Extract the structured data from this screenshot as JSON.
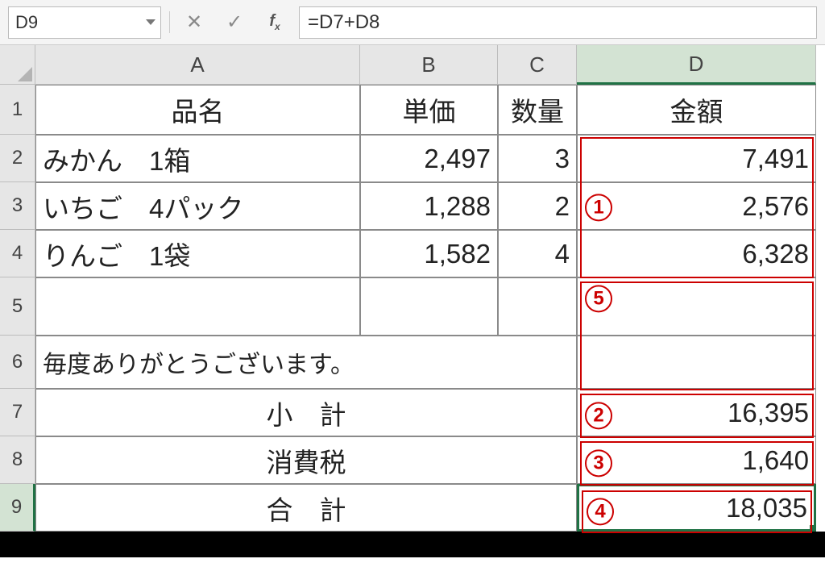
{
  "formula_bar": {
    "name_box": "D9",
    "cancel_glyph": "✕",
    "accept_glyph": "✓",
    "fx_label": "fx",
    "formula": "=D7+D8"
  },
  "columns": {
    "A": "A",
    "B": "B",
    "C": "C",
    "D": "D"
  },
  "rows": {
    "r1": "1",
    "r2": "2",
    "r3": "3",
    "r4": "4",
    "r5": "5",
    "r6": "6",
    "r7": "7",
    "r8": "8",
    "r9": "9"
  },
  "headers": {
    "name": "品名",
    "unit_price": "単価",
    "qty": "数量",
    "amount": "金額"
  },
  "items": [
    {
      "name": "みかん　1箱",
      "price": "2,497",
      "qty": "3",
      "amount": "7,491"
    },
    {
      "name": "いちご　4パック",
      "price": "1,288",
      "qty": "2",
      "amount": "2,576"
    },
    {
      "name": "りんご　1袋",
      "price": "1,582",
      "qty": "4",
      "amount": "6,328"
    }
  ],
  "thanks": "毎度ありがとうございます。",
  "labels": {
    "subtotal": "小　計",
    "tax": "消費税",
    "total": "合　計"
  },
  "totals": {
    "subtotal": "16,395",
    "tax": "1,640",
    "total": "18,035"
  },
  "annotations": {
    "a1": "1",
    "a2": "2",
    "a3": "3",
    "a4": "4",
    "a5": "5"
  },
  "chart_data": {
    "type": "table",
    "title": "",
    "columns": [
      "品名",
      "単価",
      "数量",
      "金額"
    ],
    "rows": [
      [
        "みかん　1箱",
        2497,
        3,
        7491
      ],
      [
        "いちご　4パック",
        1288,
        2,
        2576
      ],
      [
        "りんご　1袋",
        1582,
        4,
        6328
      ]
    ],
    "subtotal": 16395,
    "tax": 1640,
    "total": 18035,
    "active_cell": "D9",
    "formula": "=D7+D8"
  }
}
